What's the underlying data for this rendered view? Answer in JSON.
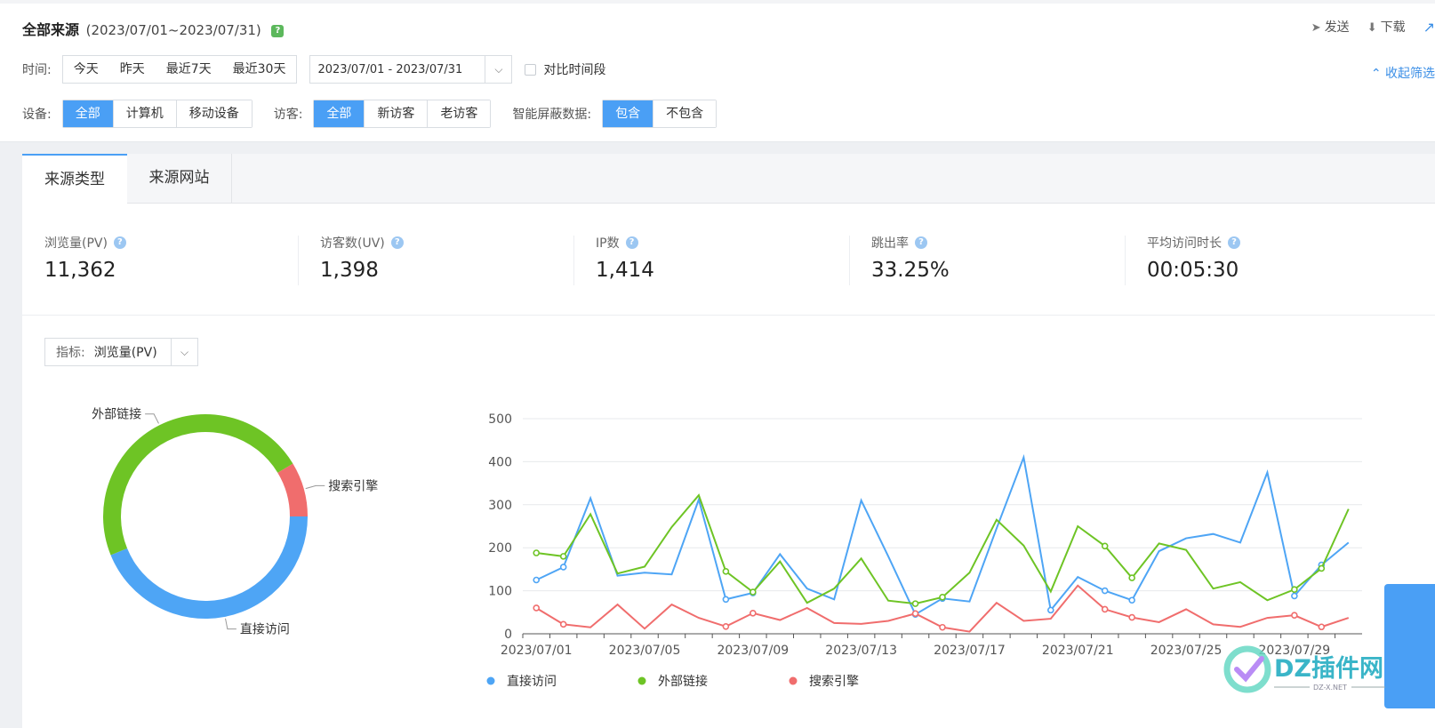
{
  "header": {
    "title": "全部来源",
    "date_range": "(2023/07/01~2023/07/31)",
    "help": "?",
    "actions": {
      "send": "发送",
      "download": "下载"
    }
  },
  "filters": {
    "time_label": "时间:",
    "time_options": [
      "今天",
      "昨天",
      "最近7天",
      "最近30天"
    ],
    "date_value": "2023/07/01 - 2023/07/31",
    "compare_label": "对比时间段",
    "collapse_label": "收起筛选",
    "device_label": "设备:",
    "device_options": [
      "全部",
      "计算机",
      "移动设备"
    ],
    "visitor_label": "访客:",
    "visitor_options": [
      "全部",
      "新访客",
      "老访客"
    ],
    "smart_label": "智能屏蔽数据:",
    "smart_options": [
      "包含",
      "不包含"
    ]
  },
  "tabs": [
    "来源类型",
    "来源网站"
  ],
  "metrics": [
    {
      "label": "浏览量(PV)",
      "value": "11,362"
    },
    {
      "label": "访客数(UV)",
      "value": "1,398"
    },
    {
      "label": "IP数",
      "value": "1,414"
    },
    {
      "label": "跳出率",
      "value": "33.25%"
    },
    {
      "label": "平均访问时长",
      "value": "00:05:30"
    }
  ],
  "metric_select": {
    "key": "指标:",
    "value": "浏览量(PV)"
  },
  "colors": {
    "direct": "#4ea5f5",
    "external": "#6ec425",
    "search": "#f06d6d",
    "accent": "#4a9ff5"
  },
  "watermark": {
    "brand": "DZ插件网",
    "domain": "DZ-X.NET"
  },
  "chart_data": [
    {
      "type": "pie",
      "donut": true,
      "labels": [
        "直接访问",
        "外部链接",
        "搜索引擎"
      ],
      "values": [
        4980,
        5400,
        982
      ],
      "colors": [
        "#4ea5f5",
        "#6ec425",
        "#f06d6d"
      ]
    },
    {
      "type": "line",
      "x": [
        "2023/07/01",
        "2023/07/02",
        "2023/07/03",
        "2023/07/04",
        "2023/07/05",
        "2023/07/06",
        "2023/07/07",
        "2023/07/08",
        "2023/07/09",
        "2023/07/10",
        "2023/07/11",
        "2023/07/12",
        "2023/07/13",
        "2023/07/14",
        "2023/07/15",
        "2023/07/16",
        "2023/07/17",
        "2023/07/18",
        "2023/07/19",
        "2023/07/20",
        "2023/07/21",
        "2023/07/22",
        "2023/07/23",
        "2023/07/24",
        "2023/07/25",
        "2023/07/26",
        "2023/07/27",
        "2023/07/28",
        "2023/07/29",
        "2023/07/30",
        "2023/07/31"
      ],
      "tick_labels": [
        "2023/07/01",
        "2023/07/05",
        "2023/07/09",
        "2023/07/13",
        "2023/07/17",
        "2023/07/21",
        "2023/07/25",
        "2023/07/29"
      ],
      "ylim": [
        0,
        500
      ],
      "yticks": [
        0,
        100,
        200,
        300,
        400,
        500
      ],
      "grid": true,
      "legend_position": "bottom-left",
      "series": [
        {
          "name": "直接访问",
          "color": "#4ea5f5",
          "values": [
            125,
            155,
            315,
            135,
            142,
            138,
            312,
            80,
            95,
            185,
            105,
            80,
            310,
            180,
            45,
            82,
            75,
            245,
            410,
            55,
            132,
            100,
            78,
            192,
            222,
            232,
            212,
            375,
            88,
            160,
            212
          ]
        },
        {
          "name": "外部链接",
          "color": "#6ec425",
          "values": [
            188,
            180,
            278,
            140,
            156,
            248,
            322,
            145,
            97,
            168,
            72,
            105,
            175,
            77,
            70,
            85,
            142,
            265,
            205,
            98,
            250,
            204,
            130,
            210,
            195,
            105,
            120,
            78,
            103,
            152,
            290
          ]
        },
        {
          "name": "搜索引擎",
          "color": "#f06d6d",
          "values": [
            60,
            22,
            15,
            68,
            12,
            68,
            37,
            17,
            48,
            32,
            60,
            25,
            23,
            30,
            47,
            15,
            5,
            72,
            30,
            35,
            112,
            57,
            38,
            27,
            57,
            22,
            16,
            37,
            43,
            16,
            37
          ]
        }
      ]
    }
  ]
}
